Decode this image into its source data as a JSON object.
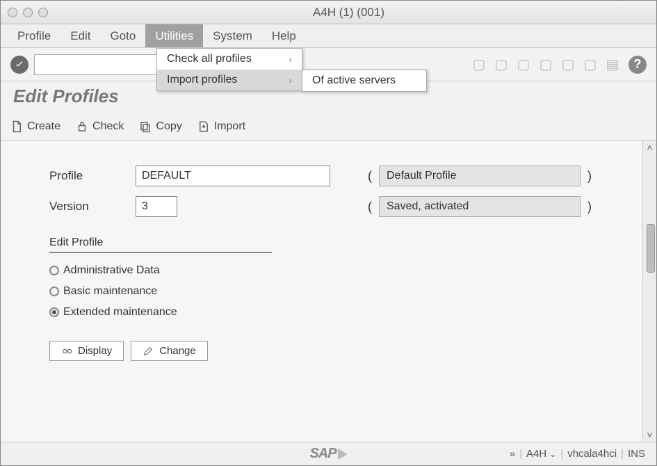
{
  "title": "A4H (1) (001)",
  "menubar": [
    "Profile",
    "Edit",
    "Goto",
    "Utilities",
    "System",
    "Help"
  ],
  "dropdown": {
    "items": [
      {
        "label": "Check all profiles"
      },
      {
        "label": "Import profiles"
      }
    ],
    "submenu": {
      "label": "Of active servers"
    }
  },
  "heading": "Edit Profiles",
  "subtoolbar": {
    "create": "Create",
    "check": "Check",
    "copy": "Copy",
    "import": "Import"
  },
  "form": {
    "profile_label": "Profile",
    "profile_value": "DEFAULT",
    "profile_desc": "Default Profile",
    "version_label": "Version",
    "version_value": "3",
    "version_desc": "Saved, activated"
  },
  "group": {
    "title": "Edit Profile",
    "opt1": "Administrative Data",
    "opt2": "Basic maintenance",
    "opt3": "Extended maintenance"
  },
  "buttons": {
    "display": "Display",
    "change": "Change"
  },
  "statusbar": {
    "chevrons": "»",
    "system": "A4H",
    "host": "vhcala4hci",
    "mode": "INS"
  }
}
